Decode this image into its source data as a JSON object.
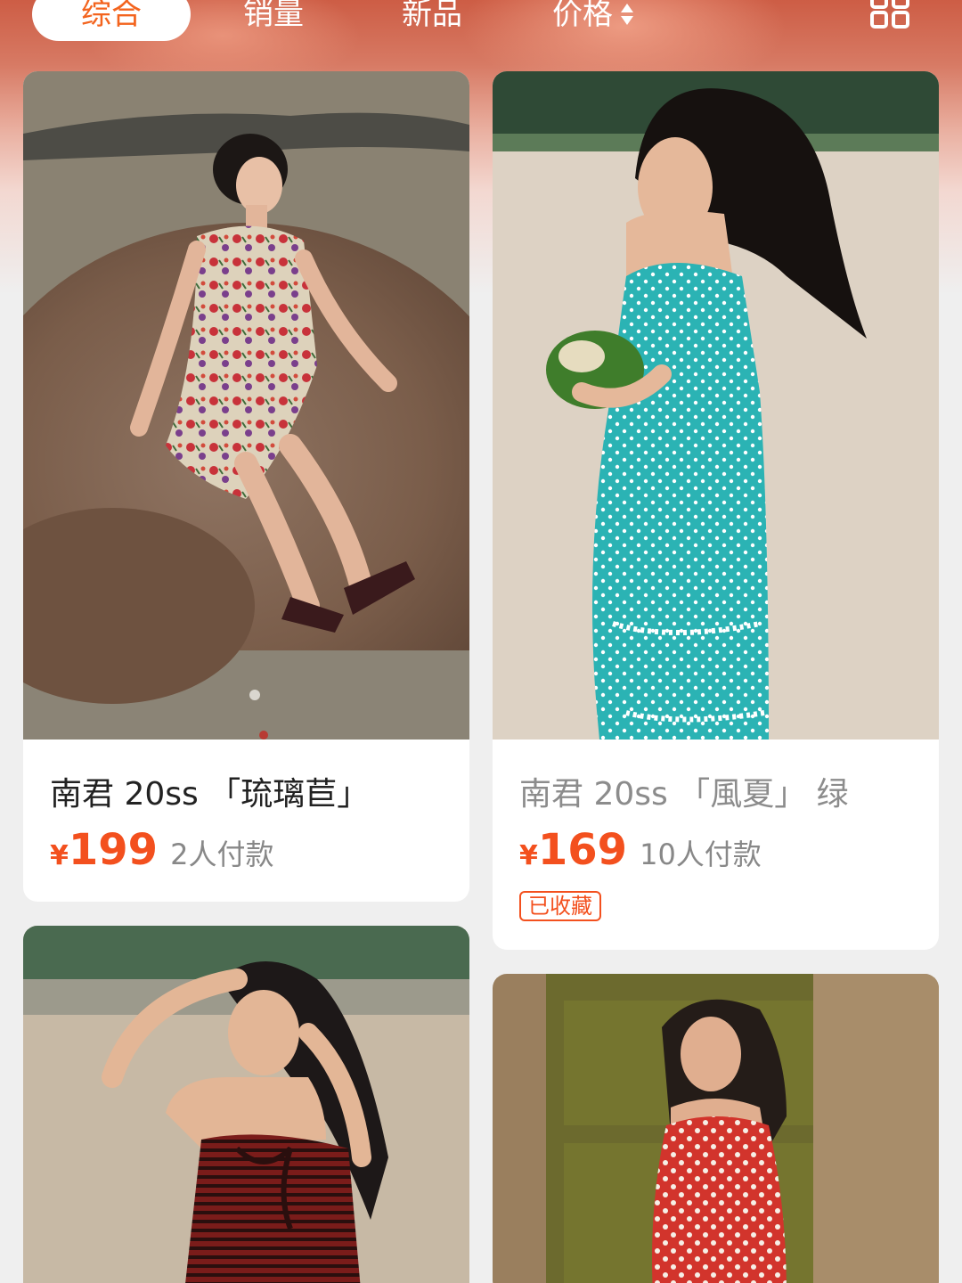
{
  "sort_tabs": {
    "comprehensive": "综合",
    "sales": "销量",
    "newest": "新品",
    "price": "价格"
  },
  "icons": {
    "price_sort": "up-down-triangle-icon",
    "layout_toggle": "grid-layout-icon"
  },
  "colors": {
    "accent": "#f3501e",
    "header_gradient_top": "#cd5d45"
  },
  "products": [
    {
      "title": "南君 20ss 「琉璃苣」",
      "currency": "¥",
      "price": "199",
      "buyers": "2人付款",
      "photo": "woman in floral halter dress sitting on a beach rock"
    },
    {
      "title": "南君 20ss 「風夏」 绿",
      "currency": "¥",
      "price": "169",
      "buyers": "10人付款",
      "badge": "已收藏",
      "photo": "woman in teal polka-dot dress holding a coconut on sand"
    },
    {
      "photo": "woman in red-striped strapless dress on the beach"
    },
    {
      "photo": "woman in red polka-dot halter dress by a green door"
    }
  ]
}
